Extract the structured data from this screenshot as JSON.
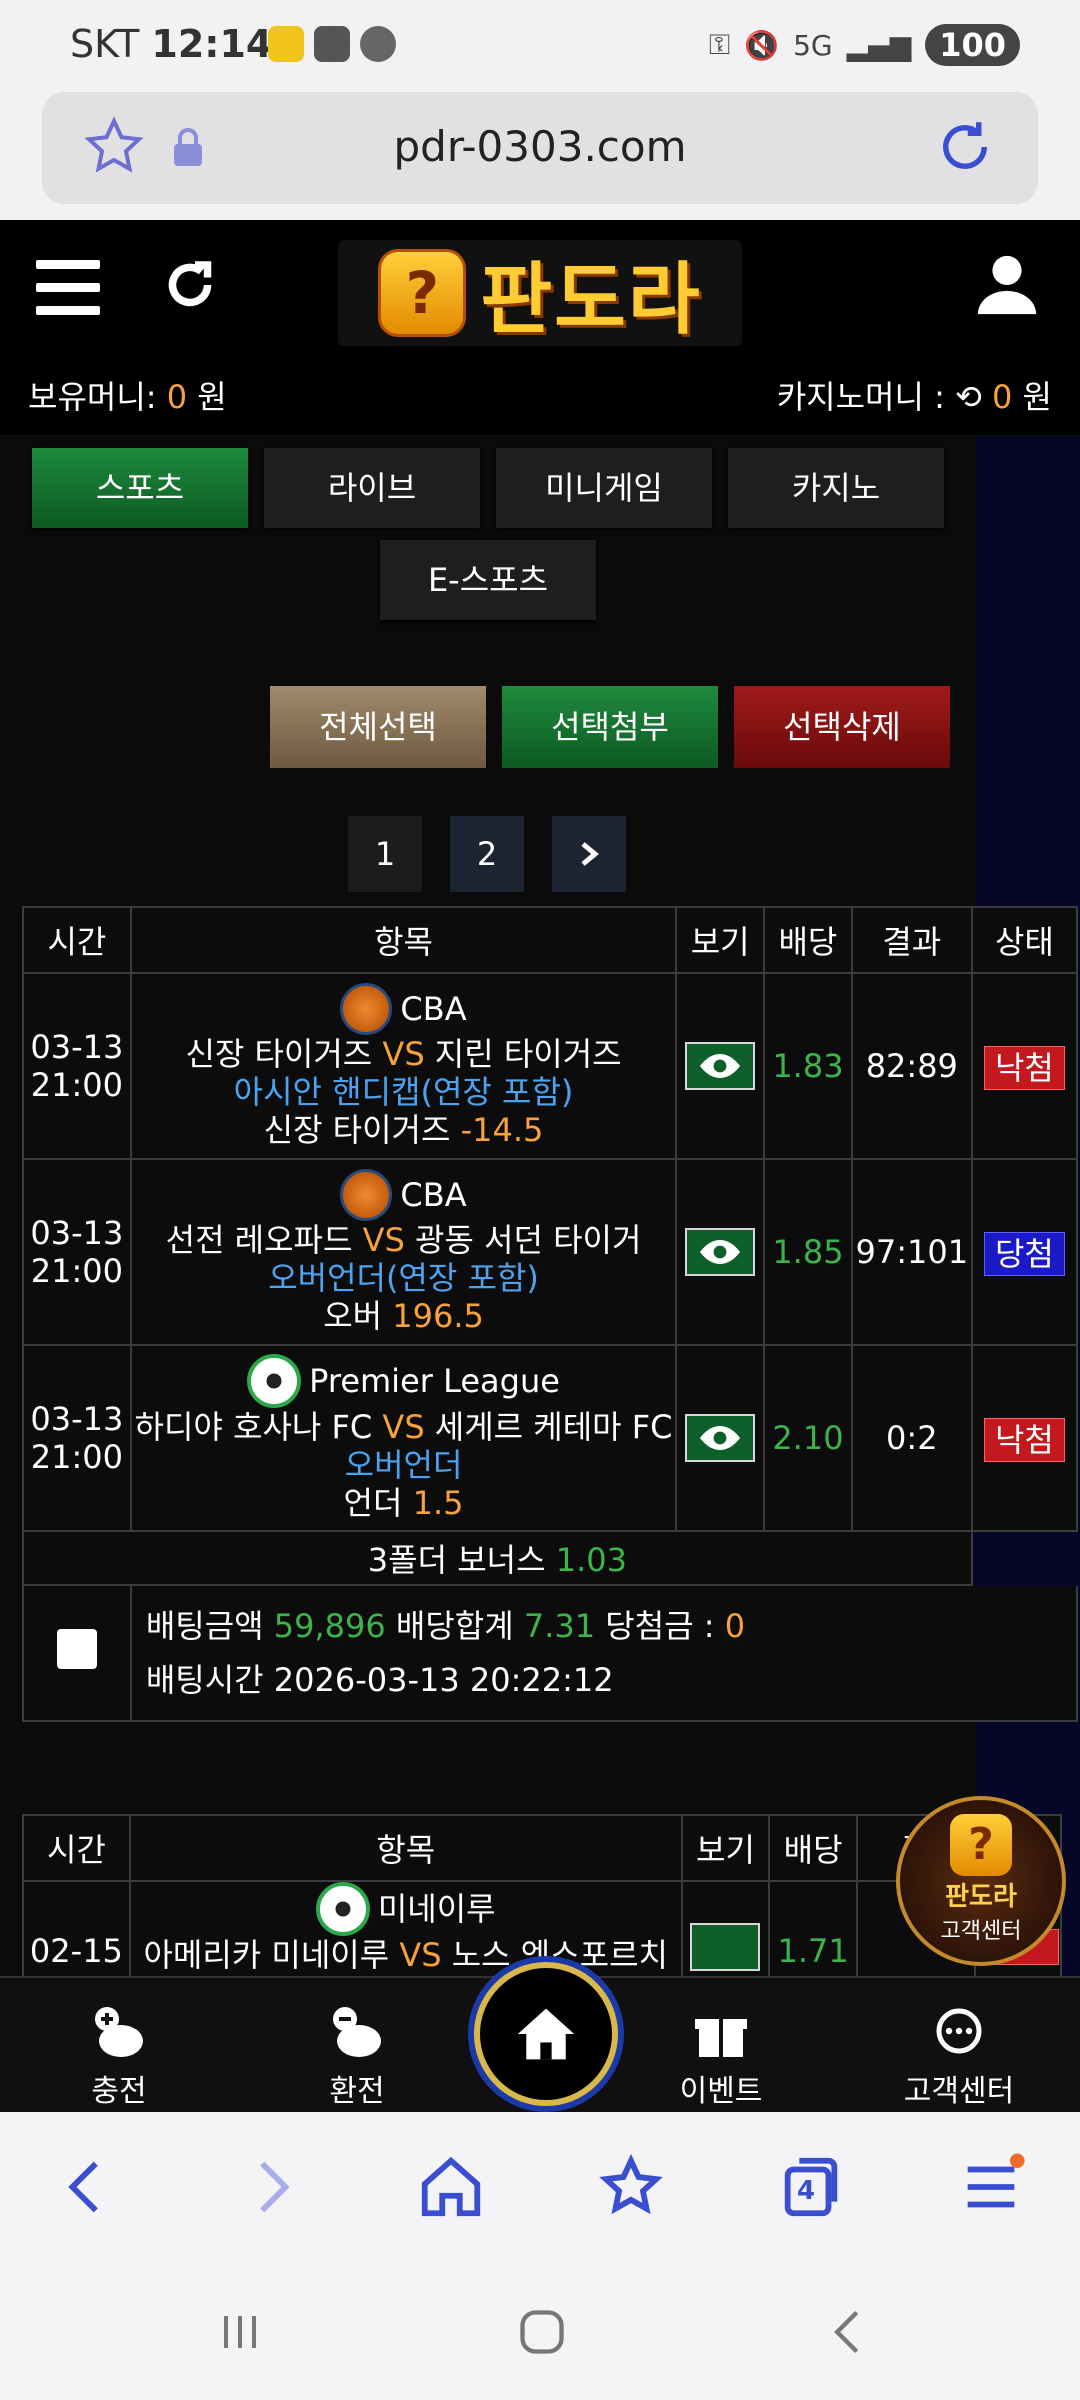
{
  "status_bar": {
    "carrier": "SKT",
    "time": "12:14",
    "network": "5G",
    "battery": "100"
  },
  "browser": {
    "url": "pdr-0303.com",
    "tab_count": "4"
  },
  "header": {
    "logo_text": "판도라",
    "holding_money_label": "보유머니:",
    "holding_money_value": "0",
    "holding_money_unit": "원",
    "casino_money_label": "카지노머니 :",
    "casino_money_value": "0",
    "casino_money_unit": "원"
  },
  "tabs": [
    "스포츠",
    "라이브",
    "미니게임",
    "카지노",
    "E-스포츠"
  ],
  "actions": {
    "select_all": "전체선택",
    "attach": "선택첨부",
    "delete": "선택삭제"
  },
  "pagination": [
    "1",
    "2"
  ],
  "table_headers": {
    "time": "시간",
    "item": "항목",
    "view": "보기",
    "odds": "배당",
    "result": "결과",
    "status": "상태"
  },
  "bets": [
    {
      "date": "03-13",
      "time": "21:00",
      "league": "CBA",
      "home": "신장 타이거즈",
      "vs": "VS",
      "away": "지린 타이거즈",
      "market": "아시안 핸디캡(연장 포함)",
      "pick": "신장 타이거즈",
      "line": "-14.5",
      "odds": "1.83",
      "result": "82:89",
      "status": "낙첨"
    },
    {
      "date": "03-13",
      "time": "21:00",
      "league": "CBA",
      "home": "선전 레오파드",
      "vs": "VS",
      "away": "광동 서던 타이거",
      "market": "오버언더(연장 포함)",
      "pick": "오버",
      "line": "196.5",
      "odds": "1.85",
      "result": "97:101",
      "status": "당첨"
    },
    {
      "date": "03-13",
      "time": "21:00",
      "league": "Premier League",
      "home": "하디야 호사나 FC",
      "vs": "VS",
      "away": "세게르 케테마 FC",
      "market": "오버언더",
      "pick": "언더",
      "line": "1.5",
      "odds": "2.10",
      "result": "0:2",
      "status": "낙첨"
    }
  ],
  "bonus": {
    "label": "3폴더 보너스",
    "value": "1.03"
  },
  "summary": {
    "amount_label": "배팅금액",
    "amount": "59,896",
    "total_odds_label": "배당합계",
    "total_odds": "7.31",
    "win_label": "당첨금 :",
    "win": "0",
    "time_label": "배팅시간",
    "time": "2026-03-13 20:22:12"
  },
  "second_table": {
    "headers": {
      "time": "시간",
      "item": "항목",
      "view": "보기",
      "odds": "배당",
      "result": "결"
    },
    "row": {
      "date": "02-15",
      "league": "미네이루",
      "home": "아메리카 미네이루",
      "vs": "VS",
      "away": "노스 엑스포르치 클",
      "odds": "1.71"
    }
  },
  "customer_center_float": {
    "title": "판도라",
    "subtitle": "고객센터"
  },
  "bottom_nav": {
    "charge": "충전",
    "exchange": "환전",
    "event": "이벤트",
    "support": "고객센터"
  },
  "colors": {
    "accent_orange": "#f7a23a",
    "odds_green": "#3cb44b",
    "market_blue": "#4da3f0",
    "lose_red": "#c3181d",
    "win_blue": "#1a1ac8"
  }
}
